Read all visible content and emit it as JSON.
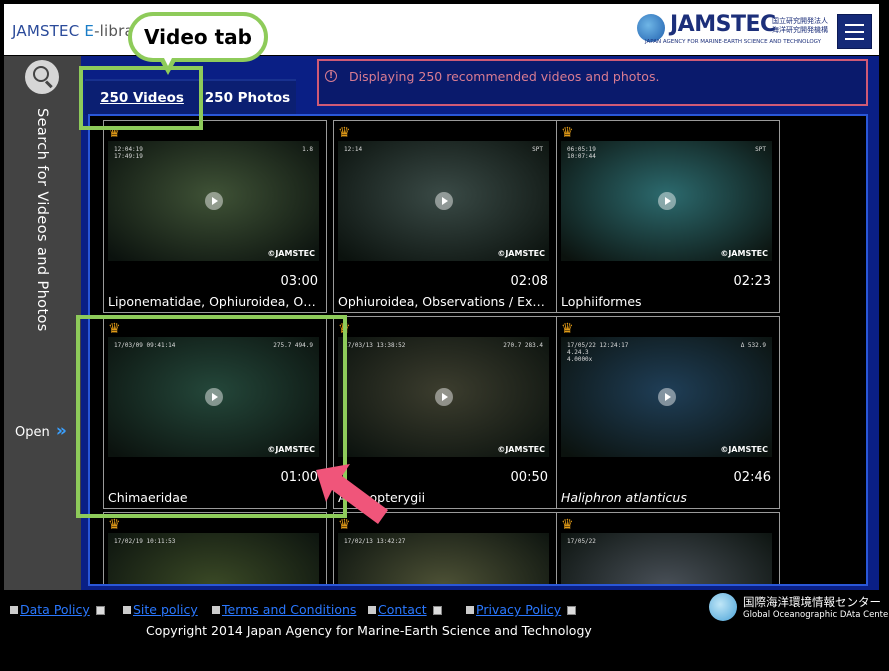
{
  "header": {
    "app_title_prefix": "JAMSTEC ",
    "app_title_e": "E",
    "app_title_suffix": "-libra          nages（J-EDI）",
    "logo_text": "JAMSTEC",
    "logo_jp_line1": "国立研究開発法人",
    "logo_jp_line2": "海洋研究開発機構",
    "logo_subtitle": "JAPAN AGENCY FOR MARINE-EARTH SCIENCE AND TECHNOLOGY",
    "menu_icon": "hamburger-menu-icon"
  },
  "sidebar": {
    "search_icon": "magnifier-icon",
    "label": "Search for Videos and Photos",
    "open_label": "Open",
    "open_icon": "double-chevron-right-icon"
  },
  "tabs": [
    {
      "label": "250 Videos",
      "active": true
    },
    {
      "label": "250 Photos",
      "active": false
    }
  ],
  "notice": {
    "icon": "error-circle-icon",
    "text": "Displaying 250 recommended videos and photos."
  },
  "cards": [
    {
      "caption": "Liponematidae, Ophiuroidea, Obse…",
      "duration": "03:00",
      "italic": false,
      "watermark": "©JAMSTEC",
      "osd_left": "12:04:19\n17:49:19",
      "osd_right": "1.8",
      "bg": "#3f5236"
    },
    {
      "caption": "Ophiuroidea, Observations / Exper…",
      "duration": "02:08",
      "italic": false,
      "watermark": "©JAMSTEC",
      "osd_left": "12:14",
      "osd_right": "SPT",
      "bg": "#3a4a46"
    },
    {
      "caption": "Lophiiformes",
      "duration": "02:23",
      "italic": false,
      "watermark": "©JAMSTEC",
      "osd_left": "06:05:19\n10:07:44",
      "osd_right": "SPT",
      "bg": "#2c6a6e"
    },
    {
      "caption": "Chimaeridae",
      "duration": "01:00",
      "italic": false,
      "watermark": "©JAMSTEC",
      "osd_left": "17/03/09 09:41:14",
      "osd_right": "275.7  494.9",
      "bg": "#24473a"
    },
    {
      "caption": "Actinopterygii",
      "duration": "00:50",
      "italic": false,
      "watermark": "©JAMSTEC",
      "osd_left": "17/03/13 13:38:52",
      "osd_right": "270.7  283.4",
      "bg": "#3c3d2e"
    },
    {
      "caption": "Haliphron atlanticus",
      "duration": "02:46",
      "italic": true,
      "watermark": "©JAMSTEC",
      "osd_left": "17/05/22 12:24:17\n4.24.3\n4.0000x",
      "osd_right": "Δ 532.9",
      "bg": "#1f3e57"
    },
    {
      "caption": "",
      "duration": "",
      "italic": false,
      "watermark": "",
      "osd_left": "17/02/19 10:11:53",
      "osd_right": "",
      "bg": "#3b4a26"
    },
    {
      "caption": "",
      "duration": "",
      "italic": false,
      "watermark": "",
      "osd_left": "17/02/13 13:42:27",
      "osd_right": "",
      "bg": "#4e5236"
    },
    {
      "caption": "",
      "duration": "",
      "italic": false,
      "watermark": "",
      "osd_left": "17/05/22",
      "osd_right": "",
      "bg": "#495058"
    }
  ],
  "footer": {
    "links": [
      {
        "label": "Data Policy"
      },
      {
        "label": "Site policy"
      },
      {
        "label": "Terms and Conditions"
      },
      {
        "label": "Contact"
      },
      {
        "label": "Privacy Policy"
      }
    ],
    "copyright": "Copyright 2014 Japan Agency for Marine-Earth Science and Technology",
    "godac_jp": "国際海洋環境情報センター",
    "godac_en": "Global Oceanographic DAta Center"
  },
  "annotation": {
    "bubble_text": "Video tab",
    "highlight_color": "#8ecb5a",
    "arrow_color": "#f0557a"
  }
}
